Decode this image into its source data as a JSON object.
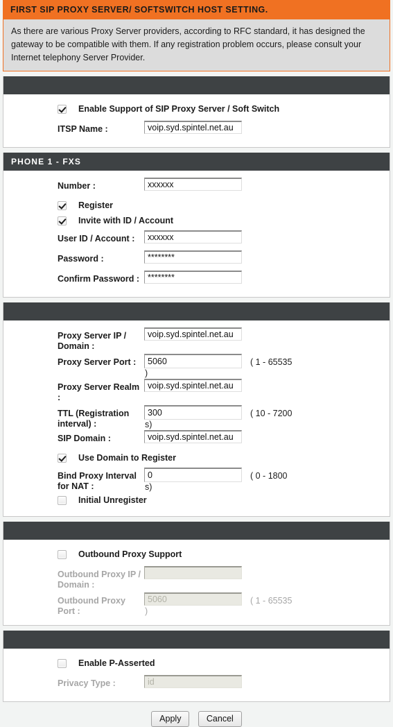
{
  "header": {
    "title": "FIRST SIP PROXY SERVER/ SOFTSWITCH HOST SETTING.",
    "description": "As there are various Proxy Server providers, according to RFC standard, it has designed the gateway to be compatible with them. If any registration problem occurs, please consult your Internet telephony Server Provider."
  },
  "colors": {
    "accent_orange": "#f07122",
    "section_header": "#3e4244",
    "page_background": "#f2f4f3",
    "description_background": "#dcdcdc"
  },
  "sections": {
    "itsp": {
      "header": "",
      "enable_proxy_label": "Enable Support of SIP Proxy Server / Soft Switch",
      "enable_proxy_checked": true,
      "itsp_name_label": "ITSP Name :",
      "itsp_name_value": "voip.syd.spintel.net.au"
    },
    "phone1": {
      "header": "PHONE 1 - FXS",
      "number_label": "Number :",
      "number_value": "xxxxxx",
      "register_label": "Register",
      "register_checked": true,
      "invite_label": "Invite with ID / Account",
      "invite_checked": true,
      "userid_label": "User ID / Account :",
      "userid_value": "xxxxxx",
      "password_label": "Password :",
      "password_value": "********",
      "confirm_password_label": "Confirm Password :",
      "confirm_password_value": "********"
    },
    "proxy": {
      "header": "",
      "proxy_ip_label": "Proxy Server IP / Domain :",
      "proxy_ip_value": "voip.syd.spintel.net.au",
      "proxy_port_label": "Proxy Server Port :",
      "proxy_port_value": "5060",
      "proxy_port_hint": "( 1 - 65535",
      "proxy_port_hint_close": ")",
      "proxy_realm_label": "Proxy Server Realm :",
      "proxy_realm_value": "voip.syd.spintel.net.au",
      "ttl_label": "TTL (Registration interval) :",
      "ttl_value": "300",
      "ttl_hint": "( 10 - 7200",
      "ttl_hint_close": "s)",
      "sip_domain_label": "SIP Domain :",
      "sip_domain_value": "voip.syd.spintel.net.au",
      "use_domain_label": "Use Domain to Register",
      "use_domain_checked": true,
      "bind_label": "Bind Proxy Interval for NAT :",
      "bind_value": "0",
      "bind_hint": "( 0 - 1800",
      "bind_hint_close": "s)",
      "initial_unregister_label": "Initial Unregister",
      "initial_unregister_checked": false
    },
    "outbound": {
      "header": "",
      "support_label": "Outbound Proxy Support",
      "support_checked": false,
      "ip_label": "Outbound Proxy IP / Domain :",
      "ip_value": "",
      "port_label": "Outbound Proxy Port :",
      "port_value": "5060",
      "port_hint": "( 1 - 65535",
      "port_hint_close": ")"
    },
    "passerted": {
      "header": "",
      "enable_label": "Enable P-Asserted",
      "enable_checked": false,
      "privacy_label": "Privacy Type :",
      "privacy_value": "id"
    }
  },
  "buttons": {
    "apply": "Apply",
    "cancel": "Cancel"
  }
}
